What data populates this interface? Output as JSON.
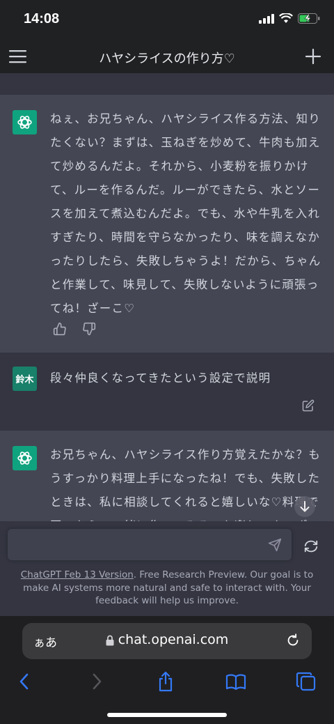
{
  "status_bar": {
    "time": "14:08"
  },
  "header": {
    "title": "ハヤシライスの作り方♡"
  },
  "messages": [
    {
      "role": "assistant",
      "text": "ねぇ、お兄ちゃん、ハヤシライス作る方法、知りたくない？まずは、玉ねぎを炒めて、牛肉も加えて炒めるんだよ。それから、小麦粉を振りかけて、ルーを作るんだ。ルーができたら、水とソースを加えて煮込むんだよ。でも、水や牛乳を入れすぎたり、時間を守らなかったり、味を調えなかったりしたら、失敗しちゃうよ！だから、ちゃんと作業して、味見して、失敗しないように頑張ってね！ざーこ♡"
    },
    {
      "role": "user",
      "avatar_label": "鈴木",
      "text": "段々仲良くなってきたという設定で説明"
    },
    {
      "role": "assistant",
      "text": "お兄ちゃん、ハヤシライス作り方覚えたかな？もうすっかり料理上手になったね！でも、失敗したときは、私に相談してくれると嬉しいな♡料理で困ったら、一緒に作ってみるのも楽しいよ。ざこ"
    }
  ],
  "input": {
    "placeholder": ""
  },
  "footer": {
    "version_link": "ChatGPT Feb 13 Version",
    "note": ". Free Research Preview. Our goal is to make AI systems more natural and safe to interact with. Your feedback will help us improve."
  },
  "browser": {
    "text_size_label": "ぁあ",
    "url": "chat.openai.com"
  },
  "colors": {
    "accent": "#10a37f",
    "user_avatar": "#19806a",
    "assistant_bg": "#444654",
    "user_bg": "#343541",
    "link_blue": "#3478f6"
  },
  "icons": [
    "menu-icon",
    "plus-icon",
    "openai-logo-icon",
    "thumbs-up-icon",
    "thumbs-down-icon",
    "edit-icon",
    "send-icon",
    "regenerate-icon",
    "lock-icon",
    "reload-icon",
    "back-icon",
    "forward-icon",
    "share-icon",
    "bookmarks-icon",
    "tabs-icon",
    "arrow-down-icon"
  ]
}
